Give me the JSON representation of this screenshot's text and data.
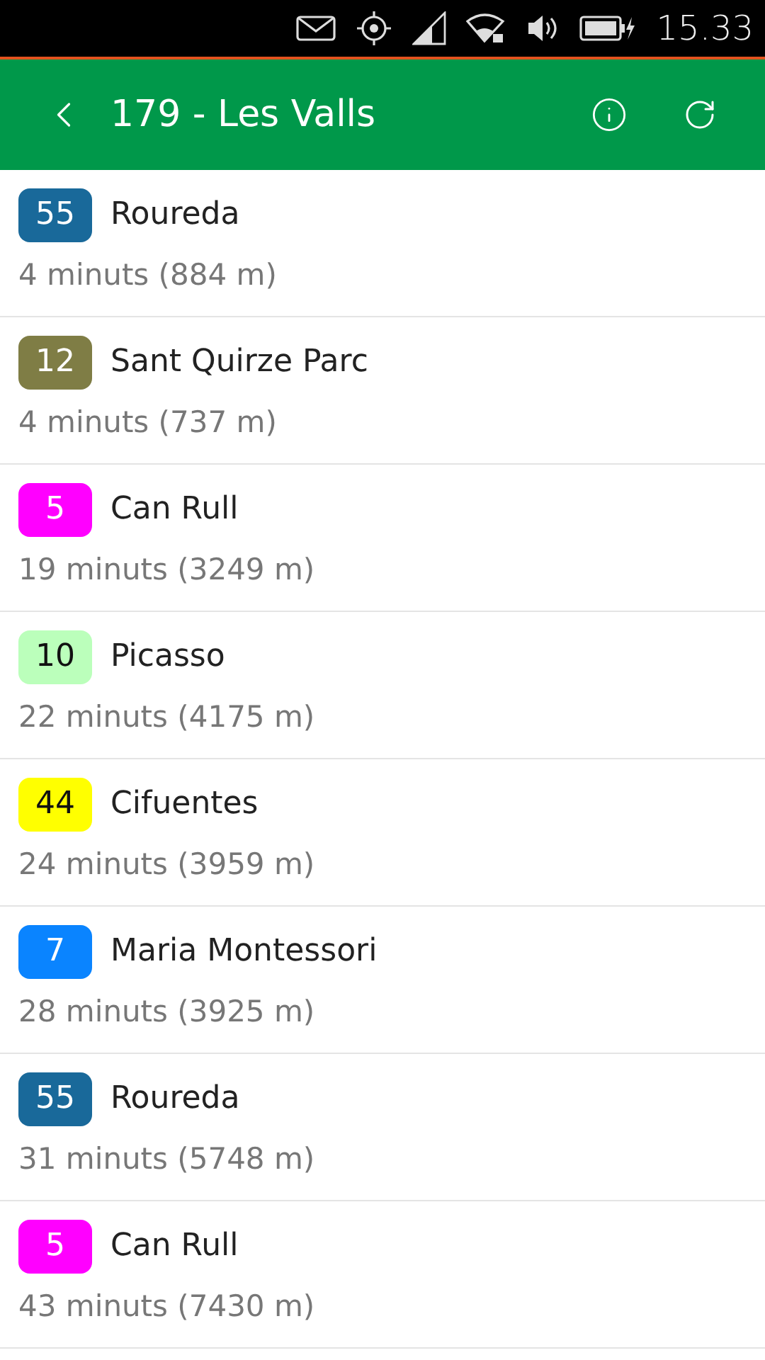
{
  "status_bar": {
    "time": "15.33"
  },
  "header": {
    "title": "179 - Les Valls"
  },
  "arrivals": [
    {
      "line": "55",
      "color": "#19699a",
      "destination": "Roureda",
      "eta": "4 minuts (884 m)"
    },
    {
      "line": "12",
      "color": "#7f7d45",
      "destination": "Sant Quirze Parc",
      "eta": "4 minuts (737 m)"
    },
    {
      "line": "5",
      "color": "#ff00ff",
      "destination": "Can Rull",
      "eta": "19 minuts (3249 m)"
    },
    {
      "line": "10",
      "color": "#bbffbb",
      "destination": "Picasso",
      "eta": "22 minuts (4175 m)"
    },
    {
      "line": "44",
      "color": "#ffff00",
      "destination": "Cifuentes",
      "eta": "24 minuts (3959 m)"
    },
    {
      "line": "7",
      "color": "#0a84ff",
      "destination": "Maria Montessori",
      "eta": "28 minuts (3925 m)"
    },
    {
      "line": "55",
      "color": "#19699a",
      "destination": "Roureda",
      "eta": "31 minuts (5748 m)"
    },
    {
      "line": "5",
      "color": "#ff00ff",
      "destination": "Can Rull",
      "eta": "43 minuts (7430 m)"
    }
  ]
}
